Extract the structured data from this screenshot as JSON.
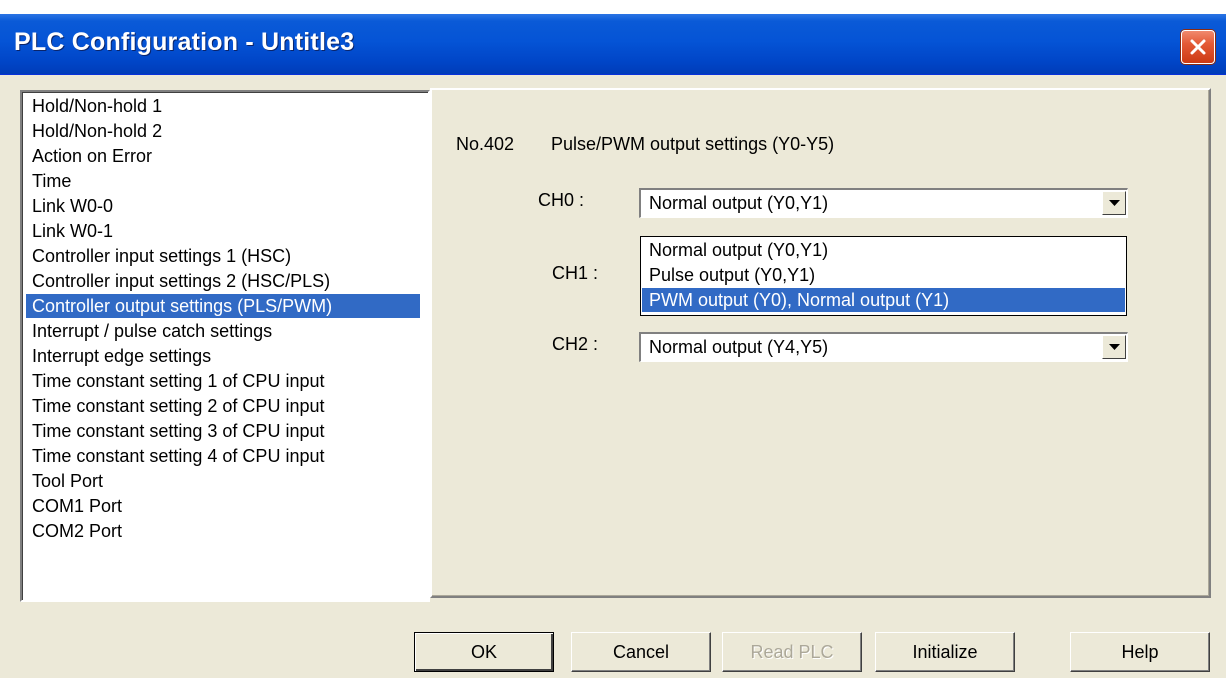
{
  "window": {
    "title": "PLC Configuration - Untitle3"
  },
  "list": {
    "items": [
      "Hold/Non-hold 1",
      "Hold/Non-hold 2",
      "Action on Error",
      "Time",
      "Link W0-0",
      "Link W0-1",
      "Controller input settings 1 (HSC)",
      "Controller input settings 2 (HSC/PLS)",
      "Controller output settings (PLS/PWM)",
      "Interrupt / pulse catch settings",
      "Interrupt edge settings",
      "Time constant setting 1 of CPU input",
      "Time constant setting 2 of CPU input",
      "Time constant setting 3 of CPU input",
      "Time constant setting 4 of CPU input",
      "Tool Port",
      "COM1 Port",
      "COM2 Port"
    ],
    "selected": "Controller output settings (PLS/PWM)"
  },
  "panel": {
    "number": "No.402",
    "heading": "Pulse/PWM output settings (Y0-Y5)",
    "ch0": {
      "label": "CH0 :",
      "value": "Normal output (Y0,Y1)"
    },
    "ch1": {
      "label": "CH1 :"
    },
    "ch2": {
      "label": "CH2 :",
      "value": "Normal output (Y4,Y5)"
    },
    "dropdown": {
      "options": [
        "Normal output (Y0,Y1)",
        "Pulse output (Y0,Y1)",
        "PWM output (Y0),  Normal output (Y1)"
      ],
      "highlighted": "PWM output (Y0),  Normal output (Y1)"
    }
  },
  "buttons": {
    "ok": "OK",
    "cancel": "Cancel",
    "read_plc": "Read PLC",
    "initialize": "Initialize",
    "help": "Help"
  },
  "colors": {
    "selection": "#316ac5",
    "titlebar": "#0554d6",
    "dialog": "#ece9d8",
    "close": "#e45a36"
  },
  "icons": {
    "close": "close-icon",
    "dropdown_arrow": "chevron-down-icon"
  }
}
